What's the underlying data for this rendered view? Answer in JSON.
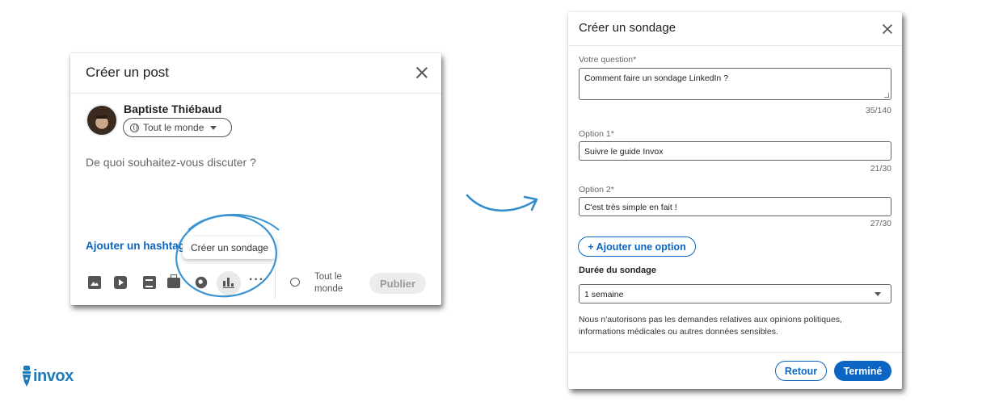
{
  "brand": {
    "logo_text": "invox",
    "accent": "#0a66c2",
    "logo_color": "#1f7ab8"
  },
  "post_modal": {
    "title": "Créer un post",
    "author_name": "Baptiste Thiébaud",
    "audience": "Tout le monde",
    "placeholder": "De quoi souhaitez-vous discuter ?",
    "hashtag_link": "Ajouter un hashtag",
    "tooltip": "Créer un sondage",
    "toolbar_icons": [
      "image-icon",
      "video-icon",
      "document-icon",
      "job-icon",
      "celebrate-icon",
      "poll-icon",
      "more-icon"
    ],
    "more_label": "···",
    "visibility_line1": "Tout le",
    "visibility_line2": "monde",
    "publish_label": "Publier"
  },
  "poll_modal": {
    "title": "Créer un sondage",
    "question": {
      "label": "Votre question",
      "required_mark": "*",
      "value": "Comment faire un sondage LinkedIn ?",
      "counter": "35/140"
    },
    "options": [
      {
        "label": "Option 1",
        "required_mark": "*",
        "value": "Suivre le guide Invox",
        "counter": "21/30"
      },
      {
        "label": "Option 2",
        "required_mark": "*",
        "value": "C'est très simple en fait !",
        "counter": "27/30"
      }
    ],
    "add_option_label": "+ Ajouter une option",
    "duration": {
      "label": "Durée du sondage",
      "value": "1 semaine"
    },
    "disclaimer": "Nous n'autorisons pas les demandes relatives aux opinions politiques, informations médicales ou autres données sensibles.",
    "back_label": "Retour",
    "done_label": "Terminé"
  }
}
